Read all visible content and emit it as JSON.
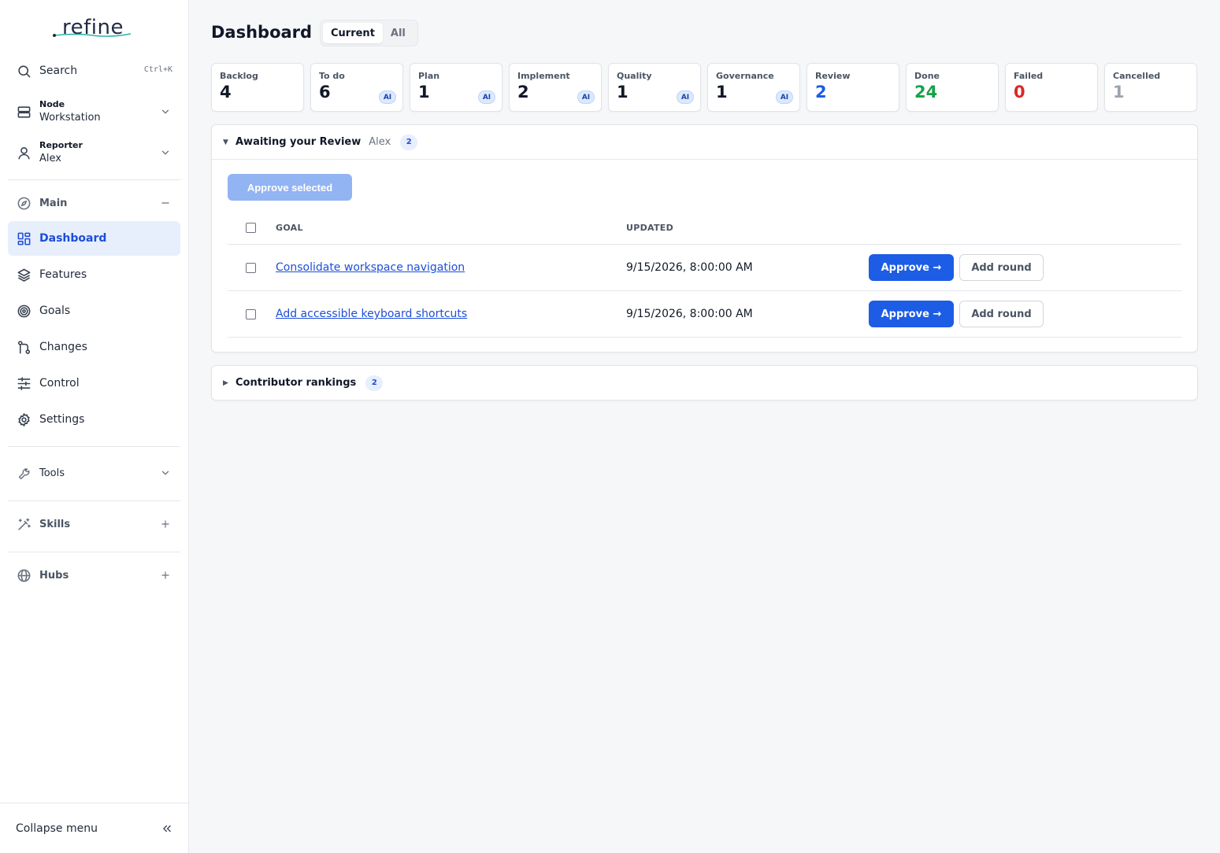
{
  "app": {
    "logo_text": "refine"
  },
  "sidebar": {
    "search": {
      "label": "Search",
      "shortcut": "Ctrl+K"
    },
    "node": {
      "label": "Node",
      "value": "Workstation"
    },
    "reporter": {
      "label": "Reporter",
      "value": "Alex"
    },
    "main_group": {
      "label": "Main"
    },
    "items": [
      {
        "label": "Dashboard",
        "icon": "grid-icon",
        "active": true
      },
      {
        "label": "Features",
        "icon": "layers-icon"
      },
      {
        "label": "Goals",
        "icon": "target-icon"
      },
      {
        "label": "Changes",
        "icon": "git-branch-icon"
      },
      {
        "label": "Control",
        "icon": "sliders-icon"
      },
      {
        "label": "Settings",
        "icon": "gear-icon"
      }
    ],
    "tools": {
      "label": "Tools"
    },
    "skills": {
      "label": "Skills"
    },
    "hubs": {
      "label": "Hubs"
    },
    "collapse": {
      "label": "Collapse menu"
    }
  },
  "header": {
    "title": "Dashboard",
    "toggle": {
      "options": [
        "Current",
        "All"
      ],
      "selected": "Current"
    }
  },
  "stats": [
    {
      "label": "Backlog",
      "value": "4",
      "ai": false,
      "color": "#111827"
    },
    {
      "label": "To do",
      "value": "6",
      "ai": true,
      "color": "#111827"
    },
    {
      "label": "Plan",
      "value": "1",
      "ai": true,
      "color": "#111827"
    },
    {
      "label": "Implement",
      "value": "2",
      "ai": true,
      "color": "#111827"
    },
    {
      "label": "Quality",
      "value": "1",
      "ai": true,
      "color": "#111827"
    },
    {
      "label": "Governance",
      "value": "1",
      "ai": true,
      "color": "#111827"
    },
    {
      "label": "Review",
      "value": "2",
      "ai": false,
      "color": "#1d5ce5"
    },
    {
      "label": "Done",
      "value": "24",
      "ai": false,
      "color": "#16a34a"
    },
    {
      "label": "Failed",
      "value": "0",
      "ai": false,
      "color": "#dc2626"
    },
    {
      "label": "Cancelled",
      "value": "1",
      "ai": false,
      "color": "#9ca3af"
    }
  ],
  "ai_badge": "AI",
  "review_panel": {
    "title": "Awaiting your Review",
    "reviewer": "Alex",
    "count": "2",
    "approve_selected": "Approve selected",
    "columns": {
      "goal": "GOAL",
      "updated": "UPDATED"
    },
    "rows": [
      {
        "goal": "Consolidate workspace navigation",
        "updated": "9/15/2026, 8:00:00 AM",
        "approve": "Approve →",
        "add_round": "Add round"
      },
      {
        "goal": "Add accessible keyboard shortcuts",
        "updated": "9/15/2026, 8:00:00 AM",
        "approve": "Approve →",
        "add_round": "Add round"
      }
    ]
  },
  "rankings_panel": {
    "title": "Contributor rankings",
    "count": "2"
  }
}
